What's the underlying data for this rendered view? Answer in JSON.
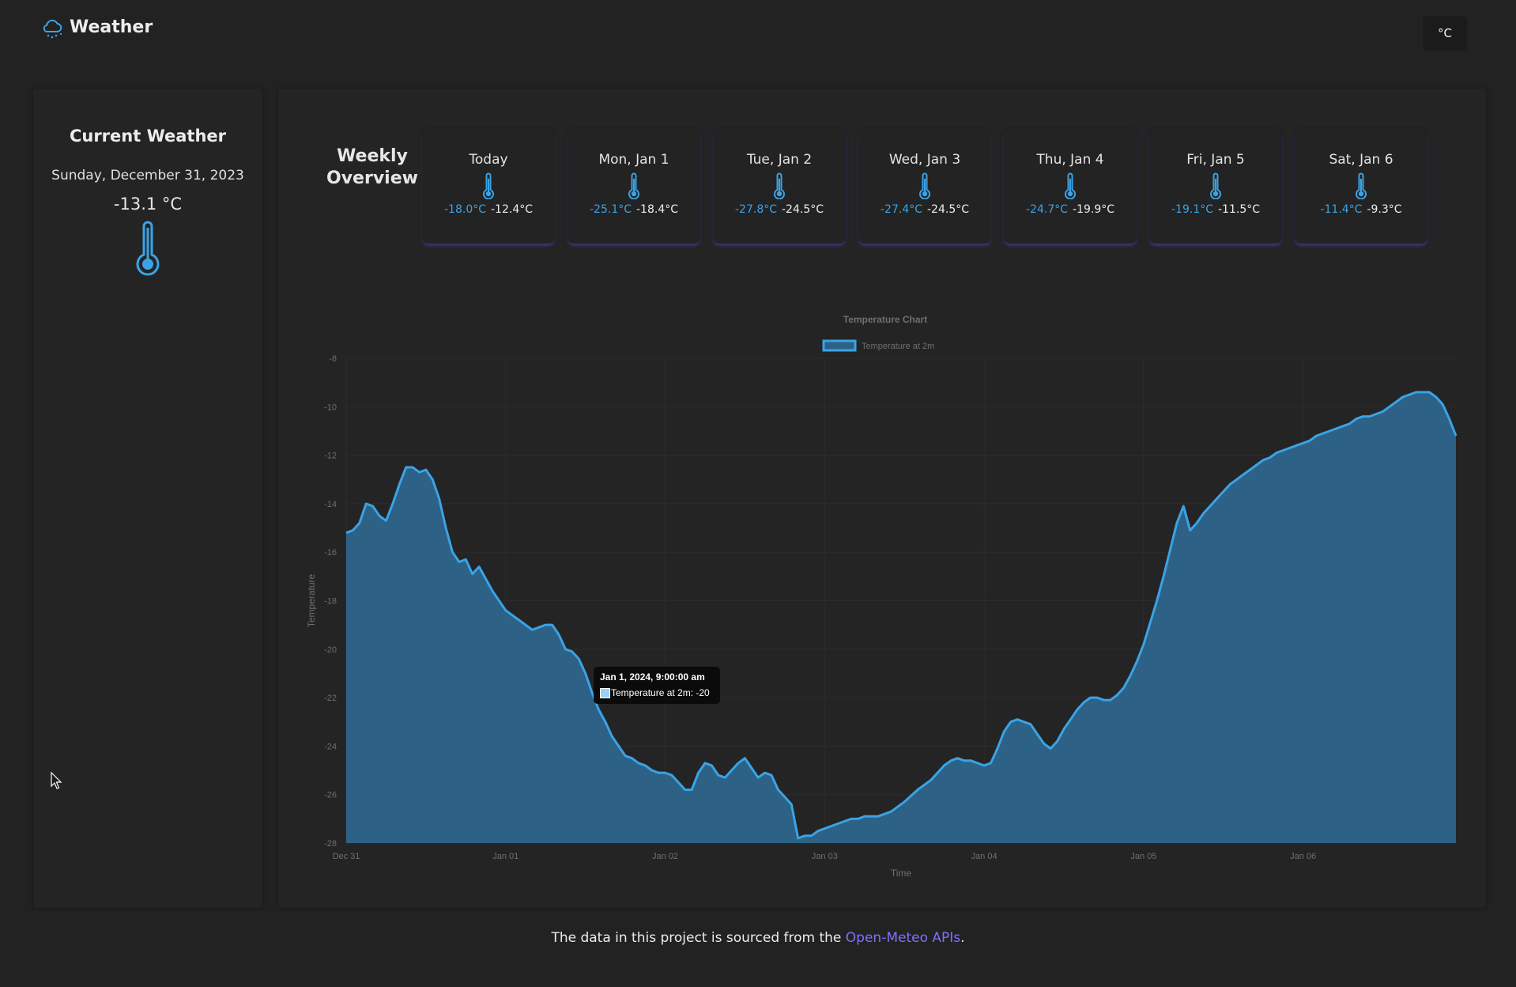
{
  "header": {
    "title": "Weather",
    "unit_button": "°C"
  },
  "current": {
    "title": "Current Weather",
    "date": "Sunday, December 31, 2023",
    "temperature": "-13.1 °C"
  },
  "weekly": {
    "label_line1": "Weekly",
    "label_line2": "Overview",
    "days": [
      {
        "name": "Today",
        "min": "-18.0°C",
        "max": "-12.4°C"
      },
      {
        "name": "Mon, Jan 1",
        "min": "-25.1°C",
        "max": "-18.4°C"
      },
      {
        "name": "Tue, Jan 2",
        "min": "-27.8°C",
        "max": "-24.5°C"
      },
      {
        "name": "Wed, Jan 3",
        "min": "-27.4°C",
        "max": "-24.5°C"
      },
      {
        "name": "Thu, Jan 4",
        "min": "-24.7°C",
        "max": "-19.9°C"
      },
      {
        "name": "Fri, Jan 5",
        "min": "-19.1°C",
        "max": "-11.5°C"
      },
      {
        "name": "Sat, Jan 6",
        "min": "-11.4°C",
        "max": "-9.3°C"
      }
    ]
  },
  "tooltip": {
    "title": "Jan 1, 2024, 9:00:00 am",
    "body": "Temperature at 2m: -20"
  },
  "footer": {
    "prefix": "The data in this project is sourced from the ",
    "link": "Open-Meteo APIs",
    "suffix": "."
  },
  "colors": {
    "accent": "#3aa3e6",
    "fill": "#2d6186",
    "link": "#7b72ff",
    "background": "#222222"
  },
  "chart_data": {
    "type": "area",
    "title": "Temperature Chart",
    "xlabel": "Time",
    "ylabel": "Temperature",
    "ylim": [
      -28,
      -8
    ],
    "yticks": [
      -8,
      -10,
      -12,
      -14,
      -16,
      -18,
      -20,
      -22,
      -24,
      -26,
      -28
    ],
    "xticks": [
      "Dec 31",
      "Jan 01",
      "Jan 02",
      "Jan 03",
      "Jan 04",
      "Jan 05",
      "Jan 06"
    ],
    "grid": true,
    "legend_position": "top",
    "x_unit": "hours from Dec 31 00:00",
    "series": [
      {
        "name": "Temperature at 2m",
        "points": [
          [
            0,
            -15.2
          ],
          [
            1,
            -15.1
          ],
          [
            2,
            -14.8
          ],
          [
            3,
            -14.0
          ],
          [
            4,
            -14.1
          ],
          [
            5,
            -14.5
          ],
          [
            6,
            -14.7
          ],
          [
            7,
            -14.0
          ],
          [
            8,
            -13.2
          ],
          [
            9,
            -12.5
          ],
          [
            10,
            -12.5
          ],
          [
            11,
            -12.7
          ],
          [
            12,
            -12.6
          ],
          [
            13,
            -13.0
          ],
          [
            14,
            -13.8
          ],
          [
            15,
            -15.0
          ],
          [
            16,
            -16.0
          ],
          [
            17,
            -16.4
          ],
          [
            18,
            -16.3
          ],
          [
            19,
            -16.9
          ],
          [
            20,
            -16.6
          ],
          [
            21,
            -17.1
          ],
          [
            22,
            -17.6
          ],
          [
            24,
            -18.4
          ],
          [
            26,
            -18.8
          ],
          [
            28,
            -19.2
          ],
          [
            30,
            -19.0
          ],
          [
            31,
            -19.0
          ],
          [
            32,
            -19.4
          ],
          [
            33,
            -20.0
          ],
          [
            34,
            -20.1
          ],
          [
            35,
            -20.4
          ],
          [
            36,
            -21.0
          ],
          [
            37,
            -21.8
          ],
          [
            38,
            -22.5
          ],
          [
            39,
            -23.0
          ],
          [
            40,
            -23.6
          ],
          [
            41,
            -24.0
          ],
          [
            42,
            -24.4
          ],
          [
            43,
            -24.5
          ],
          [
            44,
            -24.7
          ],
          [
            45,
            -24.8
          ],
          [
            46,
            -25.0
          ],
          [
            47,
            -25.1
          ],
          [
            48,
            -25.1
          ],
          [
            49,
            -25.2
          ],
          [
            50,
            -25.5
          ],
          [
            51,
            -25.8
          ],
          [
            52,
            -25.8
          ],
          [
            53,
            -25.1
          ],
          [
            54,
            -24.7
          ],
          [
            55,
            -24.8
          ],
          [
            56,
            -25.2
          ],
          [
            57,
            -25.3
          ],
          [
            58,
            -25.0
          ],
          [
            59,
            -24.7
          ],
          [
            60,
            -24.5
          ],
          [
            61,
            -24.9
          ],
          [
            62,
            -25.3
          ],
          [
            63,
            -25.1
          ],
          [
            64,
            -25.2
          ],
          [
            65,
            -25.8
          ],
          [
            66,
            -26.1
          ],
          [
            67,
            -26.4
          ],
          [
            68,
            -27.8
          ],
          [
            69,
            -27.7
          ],
          [
            70,
            -27.7
          ],
          [
            71,
            -27.5
          ],
          [
            72,
            -27.4
          ],
          [
            74,
            -27.2
          ],
          [
            76,
            -27.0
          ],
          [
            77,
            -27.0
          ],
          [
            78,
            -26.9
          ],
          [
            80,
            -26.9
          ],
          [
            82,
            -26.7
          ],
          [
            84,
            -26.3
          ],
          [
            86,
            -25.8
          ],
          [
            88,
            -25.4
          ],
          [
            89,
            -25.1
          ],
          [
            90,
            -24.8
          ],
          [
            91,
            -24.6
          ],
          [
            92,
            -24.5
          ],
          [
            93,
            -24.6
          ],
          [
            94,
            -24.6
          ],
          [
            95,
            -24.7
          ],
          [
            96,
            -24.8
          ],
          [
            97,
            -24.7
          ],
          [
            98,
            -24.1
          ],
          [
            99,
            -23.4
          ],
          [
            100,
            -23.0
          ],
          [
            101,
            -22.9
          ],
          [
            102,
            -23.0
          ],
          [
            103,
            -23.1
          ],
          [
            104,
            -23.5
          ],
          [
            105,
            -23.9
          ],
          [
            106,
            -24.1
          ],
          [
            107,
            -23.8
          ],
          [
            108,
            -23.3
          ],
          [
            109,
            -22.9
          ],
          [
            110,
            -22.5
          ],
          [
            111,
            -22.2
          ],
          [
            112,
            -22.0
          ],
          [
            113,
            -22.0
          ],
          [
            114,
            -22.1
          ],
          [
            115,
            -22.1
          ],
          [
            116,
            -21.9
          ],
          [
            117,
            -21.6
          ],
          [
            118,
            -21.1
          ],
          [
            119,
            -20.5
          ],
          [
            120,
            -19.8
          ],
          [
            121,
            -18.9
          ],
          [
            122,
            -18.0
          ],
          [
            123,
            -17.0
          ],
          [
            124,
            -15.9
          ],
          [
            125,
            -14.8
          ],
          [
            126,
            -14.1
          ],
          [
            127,
            -15.1
          ],
          [
            128,
            -14.8
          ],
          [
            129,
            -14.4
          ],
          [
            130,
            -14.1
          ],
          [
            131,
            -13.8
          ],
          [
            132,
            -13.5
          ],
          [
            133,
            -13.2
          ],
          [
            134,
            -13.0
          ],
          [
            135,
            -12.8
          ],
          [
            136,
            -12.6
          ],
          [
            137,
            -12.4
          ],
          [
            138,
            -12.2
          ],
          [
            139,
            -12.1
          ],
          [
            140,
            -11.9
          ],
          [
            141,
            -11.8
          ],
          [
            142,
            -11.7
          ],
          [
            143,
            -11.6
          ],
          [
            144,
            -11.5
          ],
          [
            145,
            -11.4
          ],
          [
            146,
            -11.2
          ],
          [
            147,
            -11.1
          ],
          [
            148,
            -11.0
          ],
          [
            149,
            -10.9
          ],
          [
            150,
            -10.8
          ],
          [
            151,
            -10.7
          ],
          [
            152,
            -10.5
          ],
          [
            153,
            -10.4
          ],
          [
            154,
            -10.4
          ],
          [
            155,
            -10.3
          ],
          [
            156,
            -10.2
          ],
          [
            157,
            -10.0
          ],
          [
            158,
            -9.8
          ],
          [
            159,
            -9.6
          ],
          [
            160,
            -9.5
          ],
          [
            161,
            -9.4
          ],
          [
            162,
            -9.4
          ],
          [
            163,
            -9.4
          ],
          [
            164,
            -9.6
          ],
          [
            165,
            -9.9
          ],
          [
            166,
            -10.5
          ],
          [
            167,
            -11.2
          ]
        ]
      }
    ]
  }
}
